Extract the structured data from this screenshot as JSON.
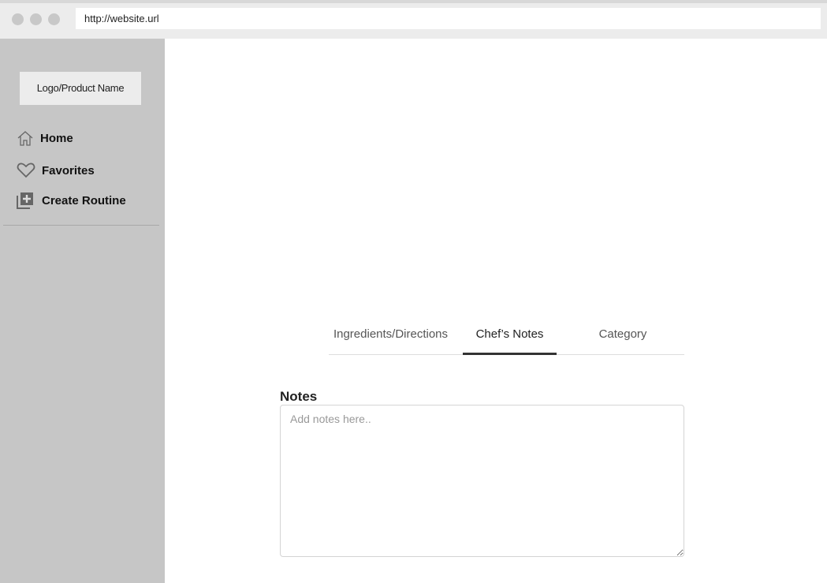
{
  "browser": {
    "url": "http://website.url"
  },
  "sidebar": {
    "logo": "Logo/Product Name",
    "items": [
      {
        "label": "Home",
        "icon": "home-icon"
      },
      {
        "label": "Favorites",
        "icon": "heart-icon"
      },
      {
        "label": "Create Routine",
        "icon": "add-library-icon"
      }
    ]
  },
  "tabs": [
    {
      "label": "Ingredients/Directions"
    },
    {
      "label": "Chef’s Notes",
      "active": true
    },
    {
      "label": "Category"
    }
  ],
  "notes": {
    "label": "Notes",
    "placeholder": "Add notes here..",
    "value": ""
  }
}
